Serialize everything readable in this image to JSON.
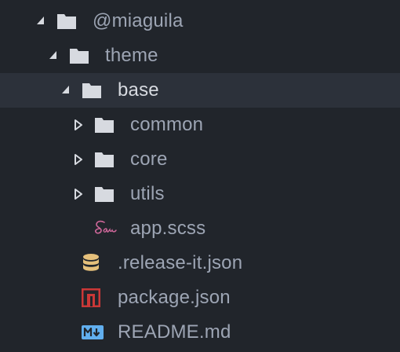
{
  "theme": {
    "background": "#21252b",
    "selected_background": "#2c313a",
    "text_color": "#9da5b4",
    "selected_text_color": "#d7dae0",
    "folder_icon_color": "#d7dae0",
    "sass_icon_color": "#cd6799",
    "json_db_icon_color": "#e5c07b",
    "npm_icon_color": "#cb3837",
    "markdown_icon_color": "#61afef"
  },
  "tree": {
    "items": [
      {
        "label": "@miaguila",
        "kind": "folder",
        "expanded": true,
        "depth": 0,
        "icon": "folder-icon",
        "arrow": "expanded-arrow-icon"
      },
      {
        "label": "theme",
        "kind": "folder",
        "expanded": true,
        "depth": 1,
        "icon": "folder-icon",
        "arrow": "expanded-arrow-icon"
      },
      {
        "label": "base",
        "kind": "folder",
        "expanded": true,
        "depth": 2,
        "selected": true,
        "icon": "folder-icon",
        "arrow": "expanded-arrow-icon"
      },
      {
        "label": "common",
        "kind": "folder",
        "expanded": false,
        "depth": 3,
        "icon": "folder-icon",
        "arrow": "collapsed-arrow-icon"
      },
      {
        "label": "core",
        "kind": "folder",
        "expanded": false,
        "depth": 3,
        "icon": "folder-icon",
        "arrow": "collapsed-arrow-icon"
      },
      {
        "label": "utils",
        "kind": "folder",
        "expanded": false,
        "depth": 3,
        "icon": "folder-icon",
        "arrow": "collapsed-arrow-icon"
      },
      {
        "label": "app.scss",
        "kind": "file",
        "depth": 3,
        "icon": "sass-icon"
      },
      {
        "label": ".release-it.json",
        "kind": "file",
        "depth": 2,
        "icon": "database-icon"
      },
      {
        "label": "package.json",
        "kind": "file",
        "depth": 2,
        "icon": "npm-icon"
      },
      {
        "label": "README.md",
        "kind": "file",
        "depth": 2,
        "icon": "markdown-icon"
      }
    ]
  }
}
